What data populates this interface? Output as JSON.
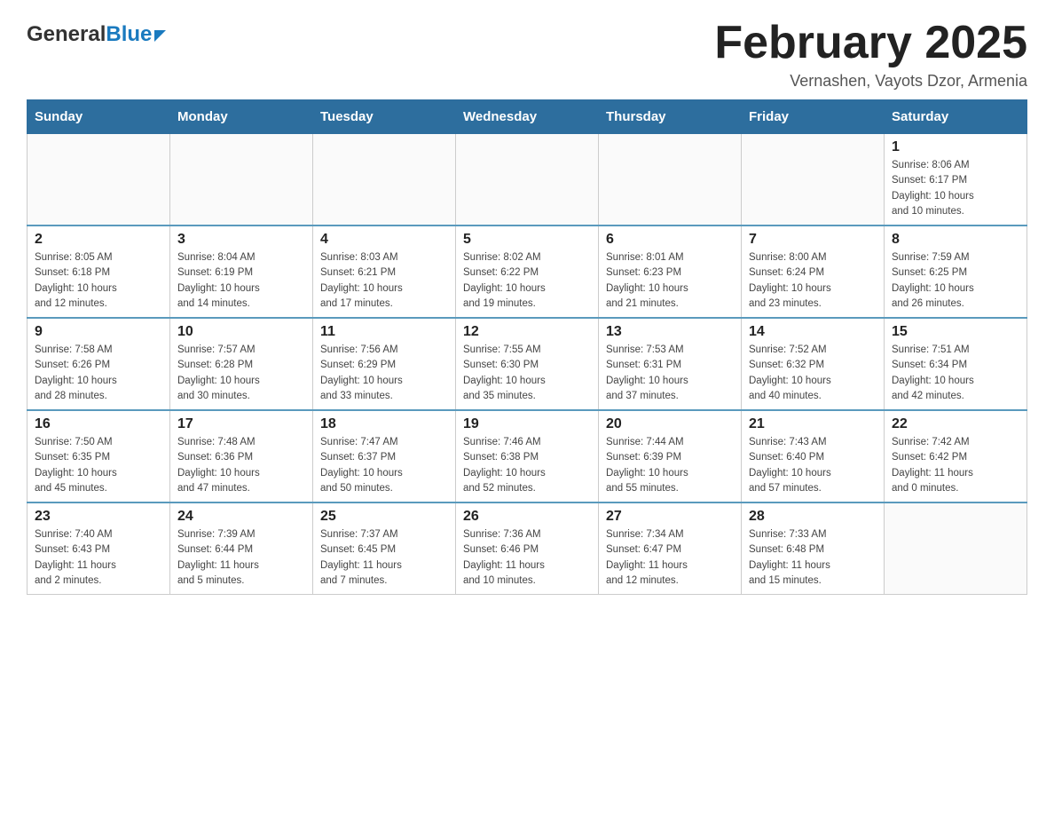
{
  "header": {
    "logo": {
      "general": "General",
      "blue": "Blue",
      "arrow": "arrow-icon"
    },
    "title": "February 2025",
    "subtitle": "Vernashen, Vayots Dzor, Armenia"
  },
  "calendar": {
    "days_of_week": [
      "Sunday",
      "Monday",
      "Tuesday",
      "Wednesday",
      "Thursday",
      "Friday",
      "Saturday"
    ],
    "weeks": [
      [
        {
          "day": "",
          "info": ""
        },
        {
          "day": "",
          "info": ""
        },
        {
          "day": "",
          "info": ""
        },
        {
          "day": "",
          "info": ""
        },
        {
          "day": "",
          "info": ""
        },
        {
          "day": "",
          "info": ""
        },
        {
          "day": "1",
          "info": "Sunrise: 8:06 AM\nSunset: 6:17 PM\nDaylight: 10 hours\nand 10 minutes."
        }
      ],
      [
        {
          "day": "2",
          "info": "Sunrise: 8:05 AM\nSunset: 6:18 PM\nDaylight: 10 hours\nand 12 minutes."
        },
        {
          "day": "3",
          "info": "Sunrise: 8:04 AM\nSunset: 6:19 PM\nDaylight: 10 hours\nand 14 minutes."
        },
        {
          "day": "4",
          "info": "Sunrise: 8:03 AM\nSunset: 6:21 PM\nDaylight: 10 hours\nand 17 minutes."
        },
        {
          "day": "5",
          "info": "Sunrise: 8:02 AM\nSunset: 6:22 PM\nDaylight: 10 hours\nand 19 minutes."
        },
        {
          "day": "6",
          "info": "Sunrise: 8:01 AM\nSunset: 6:23 PM\nDaylight: 10 hours\nand 21 minutes."
        },
        {
          "day": "7",
          "info": "Sunrise: 8:00 AM\nSunset: 6:24 PM\nDaylight: 10 hours\nand 23 minutes."
        },
        {
          "day": "8",
          "info": "Sunrise: 7:59 AM\nSunset: 6:25 PM\nDaylight: 10 hours\nand 26 minutes."
        }
      ],
      [
        {
          "day": "9",
          "info": "Sunrise: 7:58 AM\nSunset: 6:26 PM\nDaylight: 10 hours\nand 28 minutes."
        },
        {
          "day": "10",
          "info": "Sunrise: 7:57 AM\nSunset: 6:28 PM\nDaylight: 10 hours\nand 30 minutes."
        },
        {
          "day": "11",
          "info": "Sunrise: 7:56 AM\nSunset: 6:29 PM\nDaylight: 10 hours\nand 33 minutes."
        },
        {
          "day": "12",
          "info": "Sunrise: 7:55 AM\nSunset: 6:30 PM\nDaylight: 10 hours\nand 35 minutes."
        },
        {
          "day": "13",
          "info": "Sunrise: 7:53 AM\nSunset: 6:31 PM\nDaylight: 10 hours\nand 37 minutes."
        },
        {
          "day": "14",
          "info": "Sunrise: 7:52 AM\nSunset: 6:32 PM\nDaylight: 10 hours\nand 40 minutes."
        },
        {
          "day": "15",
          "info": "Sunrise: 7:51 AM\nSunset: 6:34 PM\nDaylight: 10 hours\nand 42 minutes."
        }
      ],
      [
        {
          "day": "16",
          "info": "Sunrise: 7:50 AM\nSunset: 6:35 PM\nDaylight: 10 hours\nand 45 minutes."
        },
        {
          "day": "17",
          "info": "Sunrise: 7:48 AM\nSunset: 6:36 PM\nDaylight: 10 hours\nand 47 minutes."
        },
        {
          "day": "18",
          "info": "Sunrise: 7:47 AM\nSunset: 6:37 PM\nDaylight: 10 hours\nand 50 minutes."
        },
        {
          "day": "19",
          "info": "Sunrise: 7:46 AM\nSunset: 6:38 PM\nDaylight: 10 hours\nand 52 minutes."
        },
        {
          "day": "20",
          "info": "Sunrise: 7:44 AM\nSunset: 6:39 PM\nDaylight: 10 hours\nand 55 minutes."
        },
        {
          "day": "21",
          "info": "Sunrise: 7:43 AM\nSunset: 6:40 PM\nDaylight: 10 hours\nand 57 minutes."
        },
        {
          "day": "22",
          "info": "Sunrise: 7:42 AM\nSunset: 6:42 PM\nDaylight: 11 hours\nand 0 minutes."
        }
      ],
      [
        {
          "day": "23",
          "info": "Sunrise: 7:40 AM\nSunset: 6:43 PM\nDaylight: 11 hours\nand 2 minutes."
        },
        {
          "day": "24",
          "info": "Sunrise: 7:39 AM\nSunset: 6:44 PM\nDaylight: 11 hours\nand 5 minutes."
        },
        {
          "day": "25",
          "info": "Sunrise: 7:37 AM\nSunset: 6:45 PM\nDaylight: 11 hours\nand 7 minutes."
        },
        {
          "day": "26",
          "info": "Sunrise: 7:36 AM\nSunset: 6:46 PM\nDaylight: 11 hours\nand 10 minutes."
        },
        {
          "day": "27",
          "info": "Sunrise: 7:34 AM\nSunset: 6:47 PM\nDaylight: 11 hours\nand 12 minutes."
        },
        {
          "day": "28",
          "info": "Sunrise: 7:33 AM\nSunset: 6:48 PM\nDaylight: 11 hours\nand 15 minutes."
        },
        {
          "day": "",
          "info": ""
        }
      ]
    ]
  }
}
